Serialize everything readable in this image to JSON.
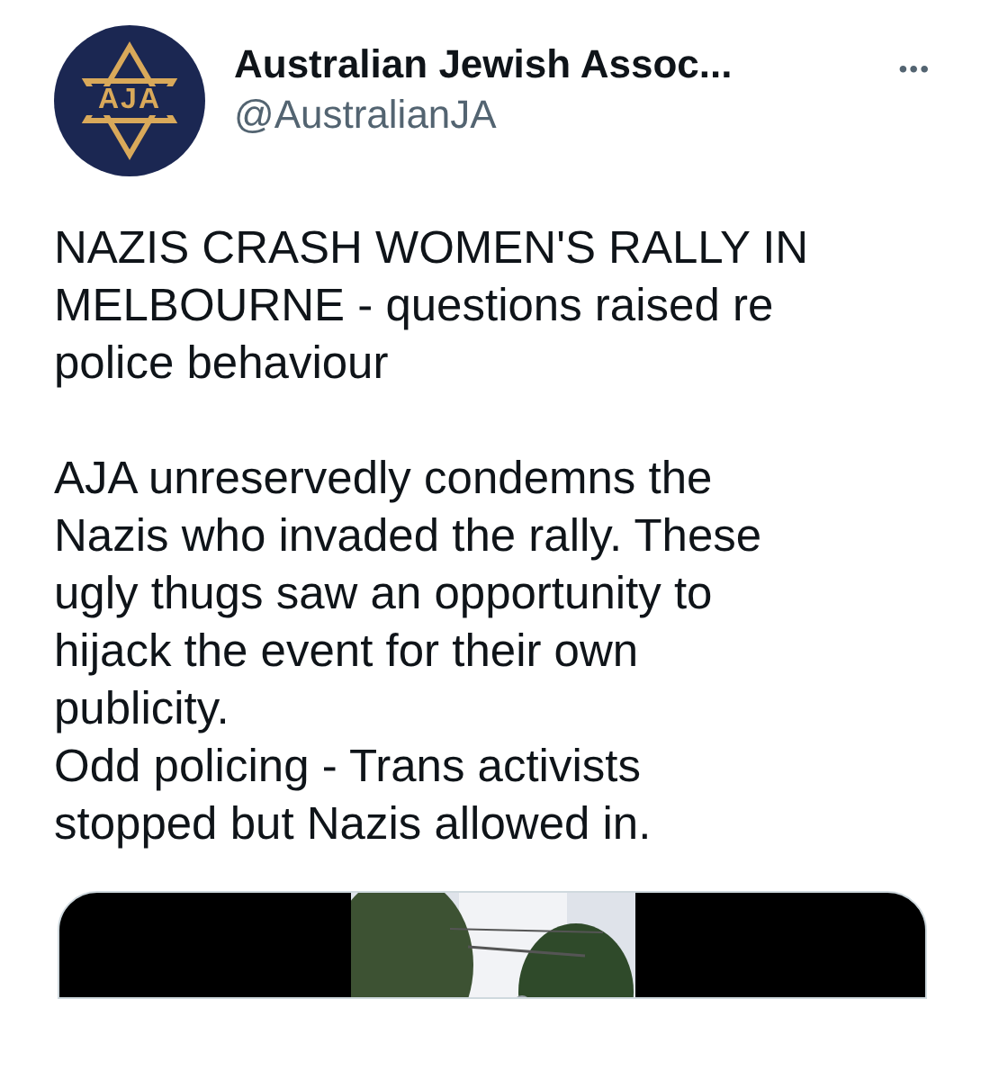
{
  "author": {
    "avatar_text": "AJA",
    "name": "Australian Jewish Assoc...",
    "handle": "@AustralianJA",
    "more": "•••"
  },
  "paragraphs": [
    {
      "lines": [
        "NAZIS CRASH WOMEN'S RALLY IN",
        "MELBOURNE - questions raised re",
        "police behaviour"
      ]
    },
    {
      "lines": [
        "AJA unreservedly condemns the",
        "Nazis who invaded the rally. These",
        "ugly thugs saw an opportunity to",
        "hijack the event for their own",
        "publicity."
      ]
    },
    {
      "lines": [
        "Odd policing - Trans activists",
        "stopped but Nazis allowed in."
      ]
    }
  ]
}
